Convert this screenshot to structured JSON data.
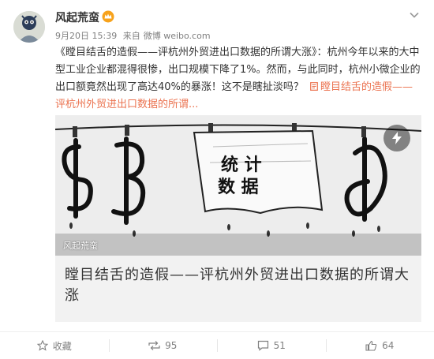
{
  "post": {
    "username": "风起荒蛮",
    "time": "9月20日 15:39",
    "source_prefix": "来自",
    "source": "微博 weibo.com",
    "text_part1": "《瞠目结舌的造假——评杭州外贸进出口数据的所谓大涨》：杭州今年以来的大中型工业企业都混得很惨，出口规模下降了1%。然而，与此同时，杭州小微企业的出口额竟然出现了高达40%的暴涨！这不是瞎扯淡吗？",
    "link_text": "瞠目结舌的造假——评杭州外贸进出口数据的所谓..."
  },
  "media": {
    "image_text": "统计\n数据",
    "watermark": "风起荒蛮",
    "title": "瞠目结舌的造假——评杭州外贸进出口数据的所谓大涨"
  },
  "footer": {
    "favorite_label": "收藏",
    "repost_count": "95",
    "comment_count": "51",
    "like_count": "64"
  },
  "colors": {
    "link": "#eb7350",
    "meta": "#808080",
    "text": "#333333"
  }
}
